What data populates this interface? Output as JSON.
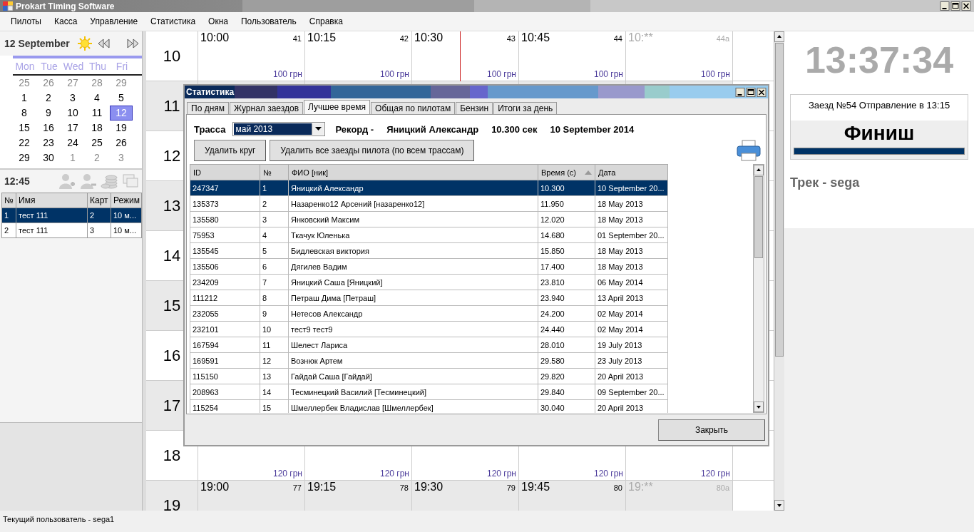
{
  "window": {
    "title": "Prokart Timing Software"
  },
  "menu": [
    "Пилоты",
    "Касса",
    "Управление",
    "Статистика",
    "Окна",
    "Пользователь",
    "Справка"
  ],
  "date_panel": {
    "title": "12 September",
    "weekdays": [
      "Mon",
      "Tue",
      "Wed",
      "Thu",
      "Fri"
    ],
    "weeks": [
      [
        {
          "day": "25",
          "muted": true,
          "selected": false
        },
        {
          "day": "26",
          "muted": true,
          "selected": false
        },
        {
          "day": "27",
          "muted": true,
          "selected": false
        },
        {
          "day": "28",
          "muted": true,
          "selected": false
        },
        {
          "day": "29",
          "muted": true,
          "selected": false
        }
      ],
      [
        {
          "day": "1",
          "muted": false,
          "selected": false
        },
        {
          "day": "2",
          "muted": false,
          "selected": false
        },
        {
          "day": "3",
          "muted": false,
          "selected": false
        },
        {
          "day": "4",
          "muted": false,
          "selected": false
        },
        {
          "day": "5",
          "muted": false,
          "selected": false
        }
      ],
      [
        {
          "day": "8",
          "muted": false,
          "selected": false
        },
        {
          "day": "9",
          "muted": false,
          "selected": false
        },
        {
          "day": "10",
          "muted": false,
          "selected": false
        },
        {
          "day": "11",
          "muted": false,
          "selected": false
        },
        {
          "day": "12",
          "muted": false,
          "selected": true
        }
      ],
      [
        {
          "day": "15",
          "muted": false,
          "selected": false
        },
        {
          "day": "16",
          "muted": false,
          "selected": false
        },
        {
          "day": "17",
          "muted": false,
          "selected": false
        },
        {
          "day": "18",
          "muted": false,
          "selected": false
        },
        {
          "day": "19",
          "muted": false,
          "selected": false
        }
      ],
      [
        {
          "day": "22",
          "muted": false,
          "selected": false
        },
        {
          "day": "23",
          "muted": false,
          "selected": false
        },
        {
          "day": "24",
          "muted": false,
          "selected": false
        },
        {
          "day": "25",
          "muted": false,
          "selected": false
        },
        {
          "day": "26",
          "muted": false,
          "selected": false
        }
      ],
      [
        {
          "day": "29",
          "muted": false,
          "selected": false
        },
        {
          "day": "30",
          "muted": false,
          "selected": false
        },
        {
          "day": "1",
          "muted": true,
          "selected": false
        },
        {
          "day": "2",
          "muted": true,
          "selected": false
        },
        {
          "day": "3",
          "muted": true,
          "selected": false
        }
      ]
    ]
  },
  "session_panel": {
    "time": "12:45",
    "columns": [
      "№",
      "Имя",
      "Карт",
      "Режим"
    ],
    "rows": [
      {
        "cells": [
          "1",
          "тест 111",
          "2",
          "10 м..."
        ],
        "selected": true
      },
      {
        "cells": [
          "2",
          "тест 111",
          "3",
          "10 м..."
        ],
        "selected": false
      }
    ]
  },
  "schedule": {
    "hours": [
      {
        "hour": "10",
        "slots": [
          {
            "kind": "slot",
            "time": "10:00",
            "number": "41",
            "price": "100 грн",
            "marked": false
          },
          {
            "kind": "slot",
            "time": "10:15",
            "number": "42",
            "price": "100 грн",
            "marked": false
          },
          {
            "kind": "slot",
            "time": "10:30",
            "number": "43",
            "price": "100 грн",
            "marked": true
          },
          {
            "kind": "slot",
            "time": "10:45",
            "number": "44",
            "price": "100 грн",
            "marked": false
          },
          {
            "kind": "open",
            "time": "10:**",
            "number": "44a",
            "price": "100 грн",
            "marked": false
          }
        ]
      },
      {
        "hour": "11"
      },
      {
        "hour": "12"
      },
      {
        "hour": "13"
      },
      {
        "hour": "14"
      },
      {
        "hour": "15"
      },
      {
        "hour": "16"
      },
      {
        "hour": "17"
      },
      {
        "hour": "18",
        "slots": [
          {
            "kind": "slot",
            "price": "120 грн",
            "marked": false
          },
          {
            "kind": "slot",
            "price": "120 грн",
            "marked": false
          },
          {
            "kind": "slot",
            "price": "120 грн",
            "marked": false
          },
          {
            "kind": "slot",
            "price": "120 грн",
            "marked": false
          },
          {
            "kind": "open",
            "price": "120 грн",
            "marked": false
          }
        ]
      },
      {
        "hour": "19",
        "slots": [
          {
            "kind": "slot",
            "time": "19:00",
            "number": "77",
            "marked": false
          },
          {
            "kind": "slot",
            "time": "19:15",
            "number": "78",
            "marked": false
          },
          {
            "kind": "slot",
            "time": "19:30",
            "number": "79",
            "marked": false
          },
          {
            "kind": "slot",
            "time": "19:45",
            "number": "80",
            "marked": false
          },
          {
            "kind": "open",
            "time": "19:**",
            "number": "80a",
            "marked": false
          }
        ]
      }
    ]
  },
  "clock": "13:37:34",
  "race_card": {
    "caption": "Заезд №54 Отправление в 13:15",
    "status": "Финиш",
    "level": 1
  },
  "track": "Трек - sega",
  "status_bar": "Текущий пользователь - sega1",
  "dialog": {
    "title": "Статистика",
    "tabs": [
      {
        "label": "По дням",
        "selected": false
      },
      {
        "label": "Журнал заездов",
        "selected": false
      },
      {
        "label": "Лучшее время",
        "selected": true
      },
      {
        "label": "Общая по пилотам",
        "selected": false
      },
      {
        "label": "Бензин",
        "selected": false
      },
      {
        "label": "Итоги за день",
        "selected": false
      }
    ],
    "track_label": "Трасса",
    "track_value": "май 2013",
    "record": [
      "Рекорд -",
      "Яницкий Александр",
      "10.300 сек",
      "10 September 2014"
    ],
    "buttons": [
      "Удалить круг",
      "Удалить все заезды пилота (по всем трассам)"
    ],
    "table": {
      "columns": [
        {
          "label": "ID",
          "sorted_ascending": false
        },
        {
          "label": "№",
          "sorted_ascending": false
        },
        {
          "label": "ФИО [ник]",
          "sorted_ascending": false
        },
        {
          "label": "Время (с)",
          "sorted_ascending": true
        },
        {
          "label": "Дата",
          "sorted_ascending": false
        }
      ],
      "rows": [
        {
          "cells": [
            "247347",
            "1",
            "Яницкий Александр",
            "10.300",
            "10 September 20..."
          ],
          "selected": true
        },
        {
          "cells": [
            "135373",
            "2",
            "Назаренко12 Арсений [назаренко12]",
            "11.950",
            "18 May 2013"
          ],
          "selected": false
        },
        {
          "cells": [
            "135580",
            "3",
            "Янковский Максим",
            "12.020",
            "18 May 2013"
          ],
          "selected": false
        },
        {
          "cells": [
            "75953",
            "4",
            "Ткачук Юленька",
            "14.680",
            "01 September 20..."
          ],
          "selected": false
        },
        {
          "cells": [
            "135545",
            "5",
            "Бидлевская виктория",
            "15.850",
            "18 May 2013"
          ],
          "selected": false
        },
        {
          "cells": [
            "135506",
            "6",
            "Дягилев Вадим",
            "17.400",
            "18 May 2013"
          ],
          "selected": false
        },
        {
          "cells": [
            "234209",
            "7",
            "Яницкий Саша [Яницкий]",
            "23.810",
            "06 May 2014"
          ],
          "selected": false
        },
        {
          "cells": [
            "111212",
            "8",
            "Петраш Дима [Петраш]",
            "23.940",
            "13 April 2013"
          ],
          "selected": false
        },
        {
          "cells": [
            "232055",
            "9",
            "Нетесов Александр",
            "24.200",
            "02 May 2014"
          ],
          "selected": false
        },
        {
          "cells": [
            "232101",
            "10",
            "тест9 тест9",
            "24.440",
            "02 May 2014"
          ],
          "selected": false
        },
        {
          "cells": [
            "167594",
            "11",
            "Шелест Лариса",
            "28.010",
            "19 July 2013"
          ],
          "selected": false
        },
        {
          "cells": [
            "169591",
            "12",
            "Вознюк Артем",
            "29.580",
            "23 July 2013"
          ],
          "selected": false
        },
        {
          "cells": [
            "115150",
            "13",
            "Гайдай Саша [Гайдай]",
            "29.820",
            "20 April 2013"
          ],
          "selected": false
        },
        {
          "cells": [
            "208963",
            "14",
            "Тесминецкий Василий [Тесминецкий]",
            "29.840",
            "09 September 20..."
          ],
          "selected": false
        },
        {
          "cells": [
            "115254",
            "15",
            "Шмеллербек Владислав [Шмеллербек]",
            "30.040",
            "20 April 2013"
          ],
          "selected": false
        }
      ]
    },
    "close_button": "Закрыть"
  }
}
